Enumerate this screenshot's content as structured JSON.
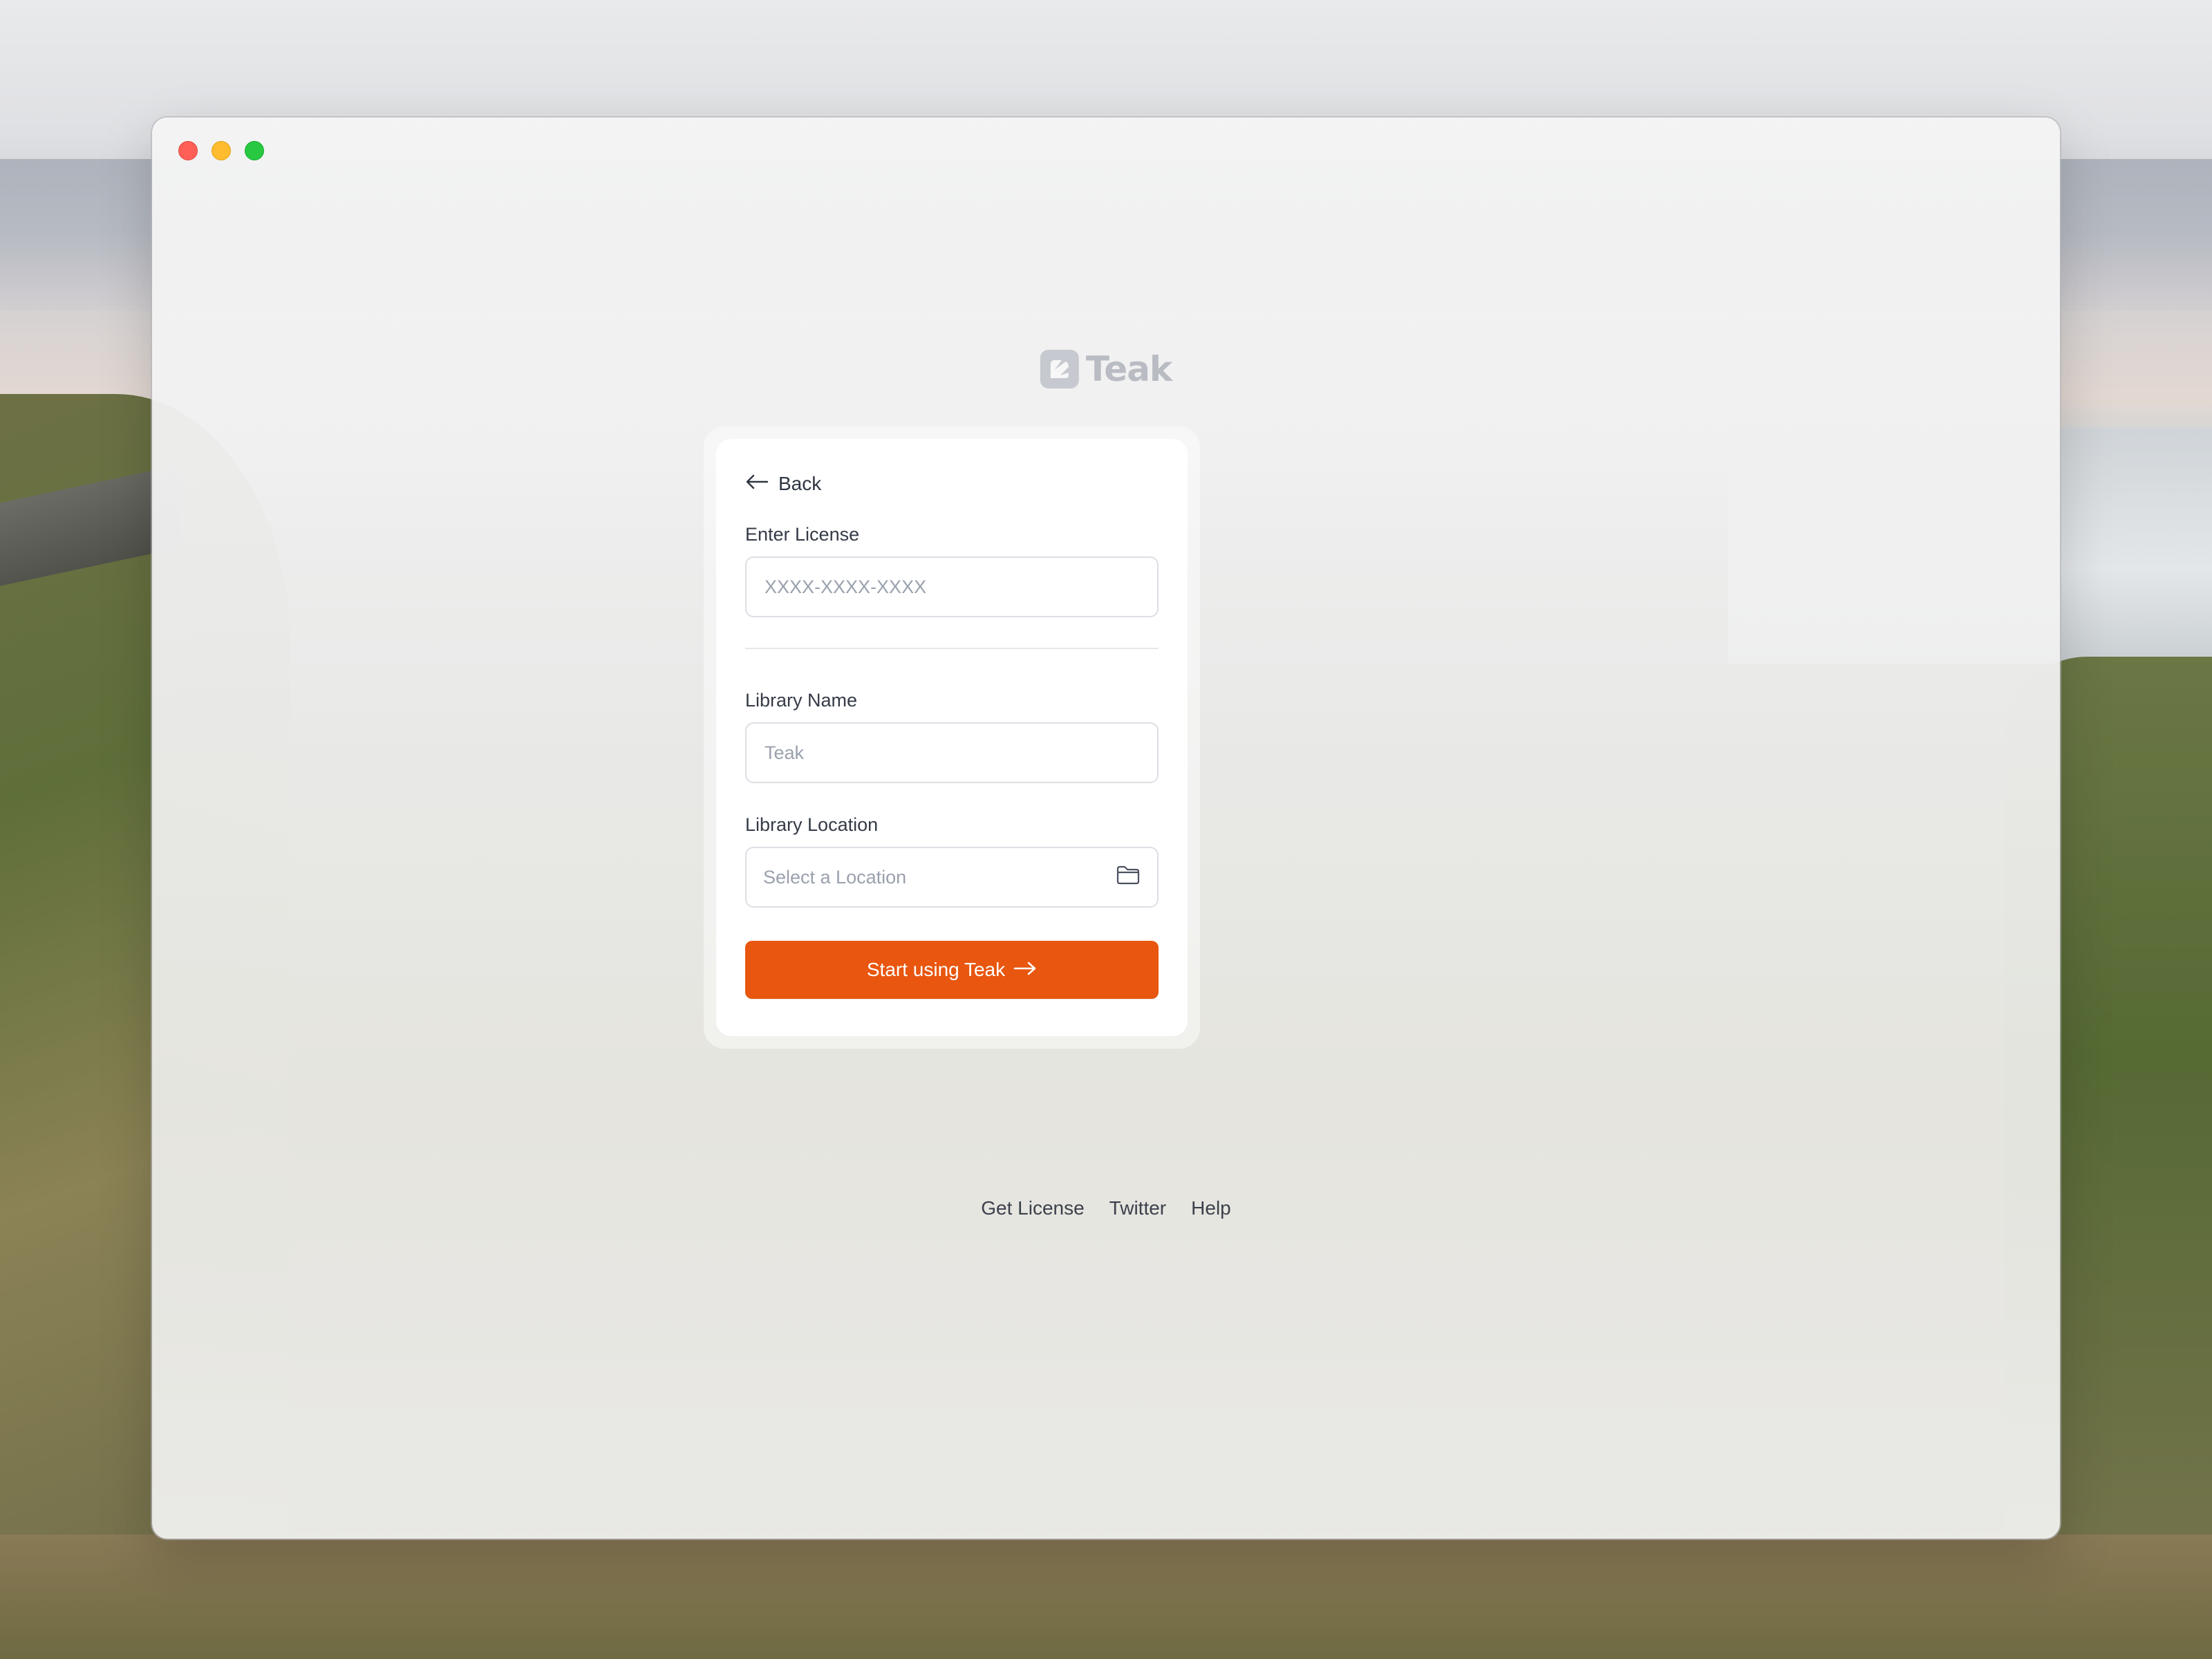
{
  "window": {
    "controls": [
      "close",
      "minimize",
      "maximize"
    ]
  },
  "app": {
    "name": "Teak"
  },
  "form": {
    "back_label": "Back",
    "license": {
      "label": "Enter License",
      "placeholder": "XXXX-XXXX-XXXX",
      "value": ""
    },
    "library_name": {
      "label": "Library Name",
      "placeholder": "Teak",
      "value": ""
    },
    "library_location": {
      "label": "Library Location",
      "placeholder": "Select a Location"
    },
    "submit_label": "Start using Teak"
  },
  "footer": {
    "links": [
      "Get License",
      "Twitter",
      "Help"
    ]
  },
  "colors": {
    "accent": "#e8560f",
    "close": "#ff5f57",
    "minimize": "#febc2e",
    "maximize": "#28c840"
  },
  "icons": [
    "teak-logo-icon",
    "arrow-left-icon",
    "folder-icon",
    "arrow-right-icon"
  ]
}
